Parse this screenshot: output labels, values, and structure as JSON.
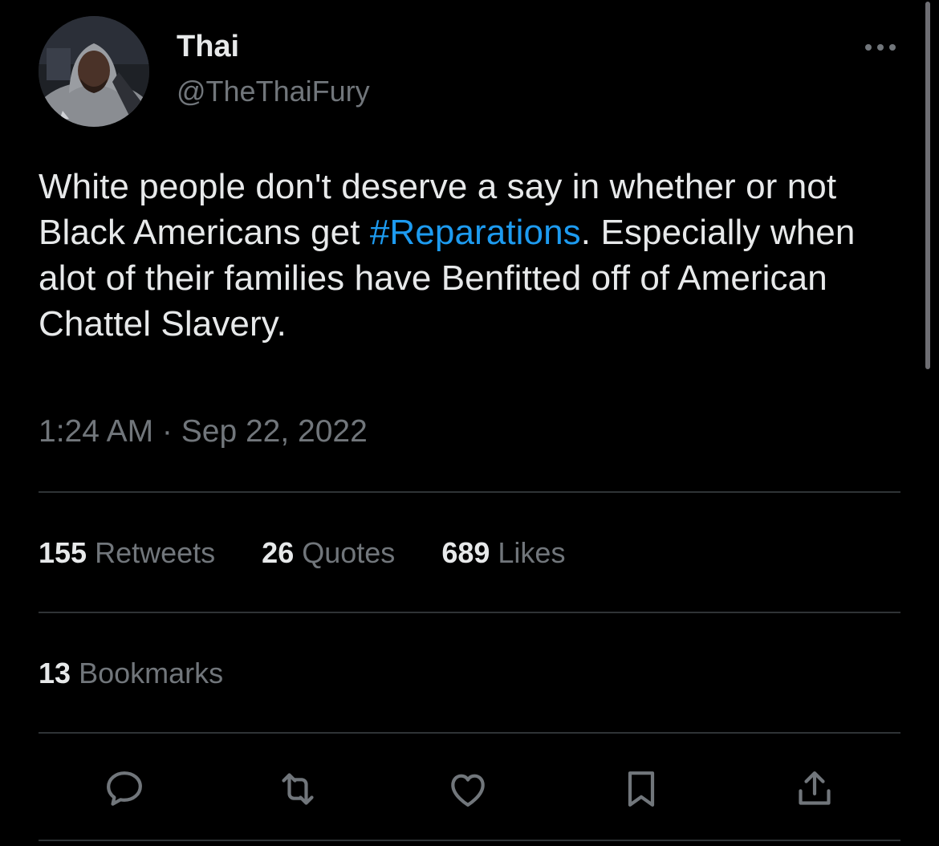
{
  "author": {
    "display_name": "Thai",
    "handle": "@TheThaiFury"
  },
  "tweet": {
    "text_before": "White people don't deserve a say in whether or not Black Americans get ",
    "hashtag": "#Reparations",
    "text_after": ". Especially when alot of their families have Benfitted off of American Chattel Slavery.",
    "timestamp": "1:24 AM · Sep 22, 2022"
  },
  "stats": {
    "retweets": {
      "count": "155",
      "label": "Retweets"
    },
    "quotes": {
      "count": "26",
      "label": "Quotes"
    },
    "likes": {
      "count": "689",
      "label": "Likes"
    },
    "bookmarks": {
      "count": "13",
      "label": "Bookmarks"
    }
  },
  "icons": {
    "more": "more-horizontal-icon",
    "reply": "reply-icon",
    "retweet": "retweet-icon",
    "like": "heart-icon",
    "bookmark": "bookmark-icon",
    "share": "share-icon"
  },
  "colors": {
    "background": "#000000",
    "text_primary": "#e7e9ea",
    "text_secondary": "#71767b",
    "accent": "#1d9bf0",
    "divider": "#2f3336"
  }
}
